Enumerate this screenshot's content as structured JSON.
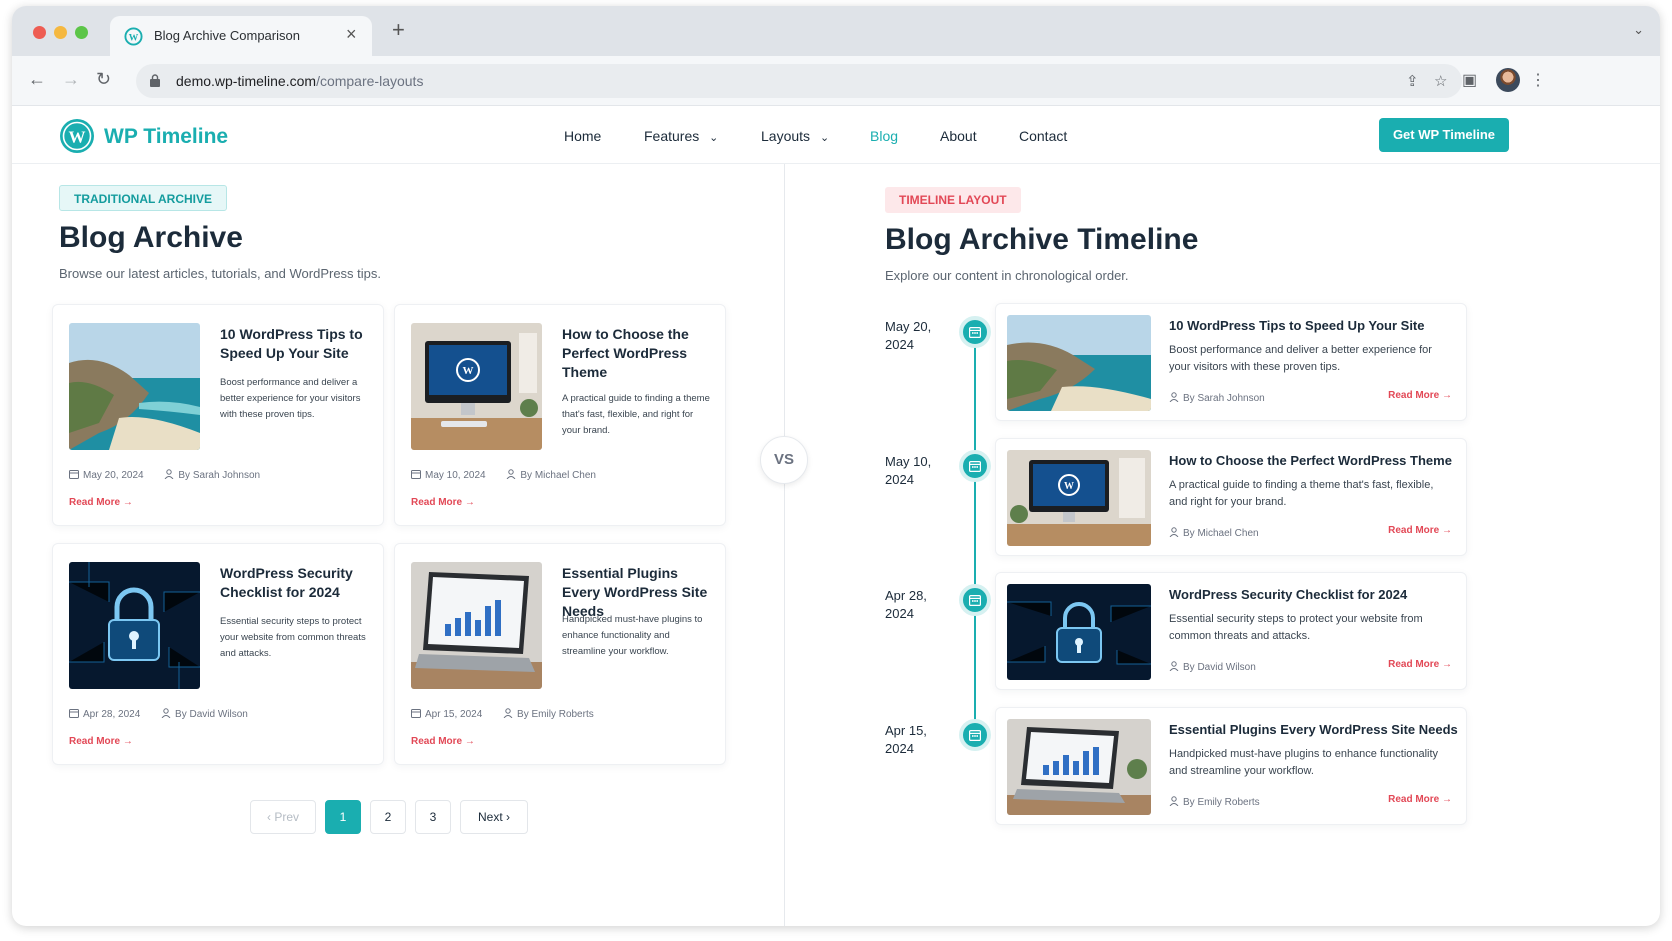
{
  "browser": {
    "tab_title": "Blog Archive Comparison",
    "url_host": "demo.wp-timeline.com",
    "url_path": "/compare-layouts"
  },
  "site": {
    "brand": "WP Timeline",
    "nav": [
      "Home",
      "Features",
      "Layouts",
      "Blog",
      "About",
      "Contact"
    ],
    "active_nav": "Blog",
    "cta": "Get WP Timeline",
    "accent": "#1aaeb0",
    "highlight": "#e24856"
  },
  "left": {
    "badge": "TRADITIONAL ARCHIVE",
    "title": "Blog Archive",
    "subtitle": "Browse our latest articles, tutorials, and WordPress tips.",
    "posts": [
      {
        "title": "10 WordPress Tips to Speed Up Your Site",
        "desc": "Boost performance and deliver a better experience for your visitors with these proven tips.",
        "date": "May 20, 2024",
        "author": "By Sarah Johnson",
        "read": "Read More →",
        "image": "coastline-photo"
      },
      {
        "title": "How to Choose the Perfect WordPress Theme",
        "desc": "A practical guide to finding a theme that's fast, flexible, and right for your brand.",
        "date": "May 10, 2024",
        "author": "By Michael Chen",
        "read": "Read More →",
        "image": "desktop-monitor-photo"
      },
      {
        "title": "WordPress Security Checklist for 2024",
        "desc": "Essential security steps to protect your website from common threats and attacks.",
        "date": "Apr 28, 2024",
        "author": "By David Wilson",
        "read": "Read More →",
        "image": "padlock-circuit-photo"
      },
      {
        "title": "Essential Plugins Every WordPress Site Needs",
        "desc": "Handpicked must-have plugins to enhance functionality and streamline your workflow.",
        "date": "Apr 15, 2024",
        "author": "By Emily Roberts",
        "read": "Read More →",
        "image": "laptop-chart-photo"
      }
    ],
    "pagination": {
      "prev": "‹ Prev",
      "pages": [
        "1",
        "2",
        "3"
      ],
      "current": "1",
      "next": "Next ›"
    }
  },
  "vs": "VS",
  "right": {
    "badge": "TIMELINE LAYOUT",
    "title": "Blog Archive Timeline",
    "subtitle": "Explore our content in chronological order.",
    "entries": [
      {
        "date_line1": "May 20,",
        "date_line2": "2024",
        "title": "10 WordPress Tips to Speed Up Your Site",
        "desc": "Boost performance and deliver a better experience for your visitors with these proven tips.",
        "author": "By Sarah Johnson",
        "read": "Read More →"
      },
      {
        "date_line1": "May 10,",
        "date_line2": "2024",
        "title": "How to Choose the Perfect WordPress Theme",
        "desc": "A practical guide to finding a theme that's fast, flexible, and right for your brand.",
        "author": "By Michael Chen",
        "read": "Read More →"
      },
      {
        "date_line1": "Apr 28,",
        "date_line2": "2024",
        "title": "WordPress Security Checklist for 2024",
        "desc": "Essential security steps to protect your website from common threats and attacks.",
        "author": "By David Wilson",
        "read": "Read More →"
      },
      {
        "date_line1": "Apr 15,",
        "date_line2": "2024",
        "title": "Essential Plugins Every WordPress Site Needs",
        "desc": "Handpicked must-have plugins to enhance functionality and streamline your workflow.",
        "author": "By Emily Roberts",
        "read": "Read More →"
      }
    ]
  }
}
